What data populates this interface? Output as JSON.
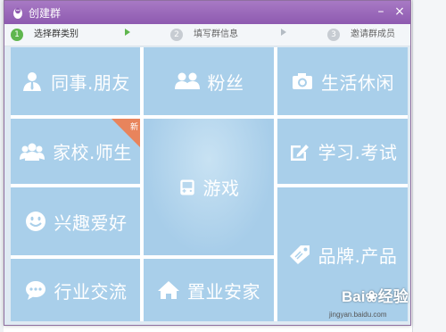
{
  "window": {
    "title": "创建群",
    "minimize_label": "–",
    "close_label": "×"
  },
  "steps": [
    {
      "num": "1",
      "label": "选择群类别"
    },
    {
      "num": "2",
      "label": "填写群信息"
    },
    {
      "num": "3",
      "label": "邀请群成员"
    }
  ],
  "categories": [
    {
      "label": "同事.朋友",
      "icon": "person-icon"
    },
    {
      "label": "粉丝",
      "icon": "people-icon"
    },
    {
      "label": "生活休闲",
      "icon": "camera-icon"
    },
    {
      "label": "家校.师生",
      "icon": "group-icon",
      "badge": "新"
    },
    {
      "label": "游戏",
      "icon": "gamepad-icon"
    },
    {
      "label": "学习.考试",
      "icon": "edit-icon"
    },
    {
      "label": "兴趣爱好",
      "icon": "smiley-icon"
    },
    {
      "label": "品牌.产品",
      "icon": "tag-icon"
    },
    {
      "label": "行业交流",
      "icon": "chat-icon"
    },
    {
      "label": "置业安家",
      "icon": "house-icon"
    }
  ],
  "watermark": {
    "logo": "Bai❀经验",
    "url": "jingyan.baidu.com"
  },
  "colors": {
    "titlebar": "#9b6bb9",
    "tile": "#a9cfea",
    "active_step": "#5fb64e",
    "badge": "#e8845c"
  }
}
